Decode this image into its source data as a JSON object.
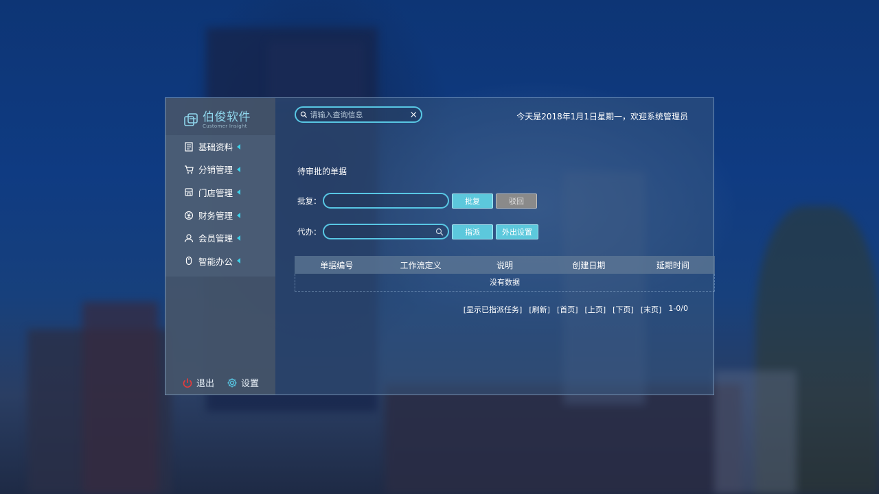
{
  "brand": {
    "name_cn": "伯俊软件",
    "name_en": "Customer Insight"
  },
  "sidebar": {
    "items": [
      {
        "label": "基础资料"
      },
      {
        "label": "分销管理"
      },
      {
        "label": "门店管理"
      },
      {
        "label": "财务管理"
      },
      {
        "label": "会员管理"
      },
      {
        "label": "智能办公"
      }
    ],
    "logout_label": "退出",
    "settings_label": "设置"
  },
  "header": {
    "search_placeholder": "请输入查询信息",
    "welcome": "今天是2018年1月1日星期一，欢迎系统管理员"
  },
  "main": {
    "section_title": "待审批的单据",
    "approve": {
      "label": "批复：",
      "value": "",
      "approve_btn": "批复",
      "reject_btn": "驳回"
    },
    "proxy": {
      "label": "代办：",
      "value": "",
      "assign_btn": "指派",
      "away_btn": "外出设置"
    },
    "table": {
      "columns": [
        "单据编号",
        "工作流定义",
        "说明",
        "创建日期",
        "延期时间"
      ],
      "empty_text": "没有数据"
    },
    "pager": {
      "show_assigned": "[显示已指派任务]",
      "refresh": "[刷新]",
      "first": "[首页]",
      "prev": "[上页]",
      "next": "[下页]",
      "last": "[末页]",
      "count": "1-0/0"
    }
  },
  "colors": {
    "accent": "#58c7e4",
    "button": "#5cc8dc",
    "caret": "#3ed0e8",
    "logout": "#e83b3b"
  }
}
